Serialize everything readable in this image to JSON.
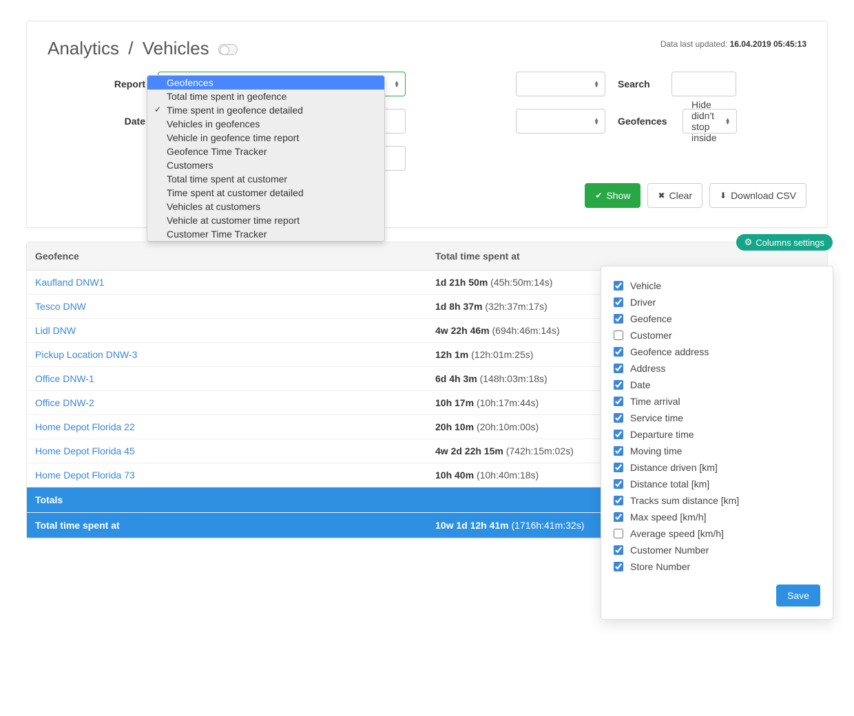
{
  "header": {
    "title_a": "Analytics",
    "title_sep": "/",
    "title_b": "Vehicles",
    "last_updated_label": "Data last updated:",
    "last_updated_ts": "16.04.2019 05:45:13"
  },
  "filters": {
    "report_label": "Report",
    "date_label": "Date",
    "search_label": "Search",
    "geofences_label": "Geofences",
    "geofences_value": "Hide didn't stop inside"
  },
  "dropdown": {
    "options": [
      {
        "label": "Geofences",
        "header": true
      },
      {
        "label": "Total time spent in geofence"
      },
      {
        "label": "Time spent in geofence detailed",
        "selected": true
      },
      {
        "label": "Vehicles in geofences"
      },
      {
        "label": "Vehicle in geofence time report"
      },
      {
        "label": "Geofence Time Tracker"
      },
      {
        "label": "Customers"
      },
      {
        "label": "Total time spent at customer"
      },
      {
        "label": "Time spent at customer detailed"
      },
      {
        "label": "Vehicles at customers"
      },
      {
        "label": "Vehicle at customer time report"
      },
      {
        "label": "Customer Time Tracker"
      }
    ]
  },
  "actions": {
    "show": "Show",
    "clear": "Clear",
    "download_csv": "Download CSV"
  },
  "table": {
    "columns_settings_label": "Columns settings",
    "col_geofence": "Geofence",
    "col_total_time": "Total time spent at",
    "rows": [
      {
        "geofence": "Kaufland DNW1",
        "time_main": "1d 21h 50m",
        "time_sub": "(45h:50m:14s)"
      },
      {
        "geofence": "Tesco DNW",
        "time_main": "1d 8h 37m",
        "time_sub": "(32h:37m:17s)"
      },
      {
        "geofence": "Lidl DNW",
        "time_main": "4w 22h 46m",
        "time_sub": "(694h:46m:14s)"
      },
      {
        "geofence": "Pickup Location DNW-3",
        "time_main": "12h 1m",
        "time_sub": "(12h:01m:25s)"
      },
      {
        "geofence": "Office DNW-1",
        "time_main": "6d 4h 3m",
        "time_sub": "(148h:03m:18s)"
      },
      {
        "geofence": "Office DNW-2",
        "time_main": "10h 17m",
        "time_sub": "(10h:17m:44s)"
      },
      {
        "geofence": "Home Depot Florida 22",
        "time_main": "20h 10m",
        "time_sub": "(20h:10m:00s)"
      },
      {
        "geofence": "Home Depot Florida 45",
        "time_main": "4w 2d 22h 15m",
        "time_sub": "(742h:15m:02s)"
      },
      {
        "geofence": "Home Depot Florida 73",
        "time_main": "10h 40m",
        "time_sub": "(10h:40m:18s)"
      }
    ],
    "totals_label": "Totals",
    "totals_row_label": "Total time spent at",
    "totals_time_main": "10w 1d 12h 41m",
    "totals_time_sub": "(1716h:41m:32s)"
  },
  "columns_panel": {
    "items": [
      {
        "label": "Vehicle",
        "checked": true
      },
      {
        "label": "Driver",
        "checked": true
      },
      {
        "label": "Geofence",
        "checked": true
      },
      {
        "label": "Customer",
        "checked": false
      },
      {
        "label": "Geofence address",
        "checked": true
      },
      {
        "label": "Address",
        "checked": true
      },
      {
        "label": "Date",
        "checked": true
      },
      {
        "label": "Time arrival",
        "checked": true
      },
      {
        "label": "Service time",
        "checked": true
      },
      {
        "label": "Departure time",
        "checked": true
      },
      {
        "label": "Moving time",
        "checked": true
      },
      {
        "label": "Distance driven [km]",
        "checked": true
      },
      {
        "label": "Distance total [km]",
        "checked": true
      },
      {
        "label": "Tracks sum distance [km]",
        "checked": true
      },
      {
        "label": "Max speed [km/h]",
        "checked": true
      },
      {
        "label": "Average speed [km/h]",
        "checked": false
      },
      {
        "label": "Customer Number",
        "checked": true
      },
      {
        "label": "Store Number",
        "checked": true
      }
    ],
    "save_label": "Save"
  }
}
